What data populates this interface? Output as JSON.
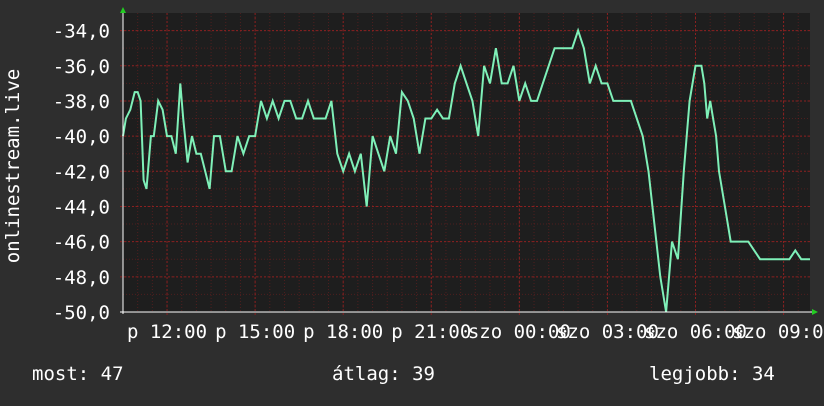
{
  "footer": {
    "current": "most: 47",
    "average": "átlag: 39",
    "best": "legjobb: 34"
  },
  "colors": {
    "background": "#2e2e2e",
    "plot_background": "#1e1e1e",
    "grid": "#8a2020",
    "line": "#7ff0b8",
    "axis_arrow": "#22cc22"
  },
  "chart_data": {
    "type": "line",
    "title": "",
    "xlabel": "",
    "ylabel": "onlinestream.live",
    "ylim": [
      -50,
      -33
    ],
    "ytick_values": [
      -34,
      -36,
      -38,
      -40,
      -42,
      -44,
      -46,
      -48,
      -50
    ],
    "ytick_labels": [
      "-34,0",
      "-36,0",
      "-38,0",
      "-40,0",
      "-42,0",
      "-44,0",
      "-46,0",
      "-48,0",
      "-50,0"
    ],
    "xlim": [
      10.5,
      33.9
    ],
    "xtick_values": [
      12,
      15,
      18,
      21,
      24,
      27,
      30,
      33
    ],
    "xtick_labels": [
      "p 12:00",
      "p 15:00",
      "p 18:00",
      "p 21:00",
      "szo 00:00",
      "szo 03:00",
      "szo 06:00",
      "szo 09:00"
    ],
    "grid": true,
    "series": [
      {
        "x": [
          10.5,
          10.6,
          10.75,
          10.9,
          11.0,
          11.1,
          11.2,
          11.3,
          11.45,
          11.55,
          11.7,
          11.85,
          12.0,
          12.15,
          12.3,
          12.45,
          12.55,
          12.7,
          12.85,
          13.0,
          13.15,
          13.3,
          13.45,
          13.6,
          13.8,
          14.0,
          14.2,
          14.4,
          14.6,
          14.8,
          15.0,
          15.2,
          15.4,
          15.6,
          15.8,
          16.0,
          16.2,
          16.4,
          16.6,
          16.8,
          17.0,
          17.2,
          17.4,
          17.6,
          17.8,
          18.0,
          18.2,
          18.4,
          18.6,
          18.8,
          19.0,
          19.2,
          19.4,
          19.6,
          19.8,
          20.0,
          20.2,
          20.4,
          20.6,
          20.8,
          21.0,
          21.2,
          21.4,
          21.6,
          21.8,
          22.0,
          22.2,
          22.4,
          22.6,
          22.8,
          23.0,
          23.2,
          23.4,
          23.6,
          23.8,
          24.0,
          24.2,
          24.4,
          24.6,
          24.8,
          25.0,
          25.2,
          25.4,
          25.6,
          25.8,
          26.0,
          26.2,
          26.4,
          26.6,
          26.8,
          27.0,
          27.2,
          27.4,
          27.6,
          27.8,
          28.0,
          28.2,
          28.4,
          28.6,
          28.8,
          29.0,
          29.2,
          29.4,
          29.6,
          29.8,
          30.0,
          30.1,
          30.2,
          30.3,
          30.4,
          30.5,
          30.6,
          30.7,
          30.8,
          31.0,
          31.2,
          31.4,
          31.6,
          31.8,
          32.0,
          32.2,
          32.4,
          32.6,
          32.8,
          33.0,
          33.2,
          33.4,
          33.6,
          33.8,
          33.9
        ],
        "y": [
          -40,
          -39,
          -38.5,
          -37.5,
          -37.5,
          -38,
          -42.5,
          -43,
          -40,
          -40,
          -38,
          -38.5,
          -40,
          -40,
          -41,
          -37,
          -39,
          -41.5,
          -40,
          -41,
          -41,
          -42,
          -43,
          -40,
          -40,
          -42,
          -42,
          -40,
          -41,
          -40,
          -40,
          -38,
          -39,
          -38,
          -39,
          -38,
          -38,
          -39,
          -39,
          -38,
          -39,
          -39,
          -39,
          -38,
          -41,
          -42,
          -41,
          -42,
          -41,
          -44,
          -40,
          -41,
          -42,
          -40,
          -41,
          -37.5,
          -38,
          -39,
          -41,
          -39,
          -39,
          -38.5,
          -39,
          -39,
          -37,
          -36,
          -37,
          -38,
          -40,
          -36,
          -37,
          -35,
          -37,
          -37,
          -36,
          -38,
          -37,
          -38,
          -38,
          -37,
          -36,
          -35,
          -35,
          -35,
          -35,
          -34,
          -35,
          -37,
          -36,
          -37,
          -37,
          -38,
          -38,
          -38,
          -38,
          -39,
          -40,
          -42,
          -45,
          -48,
          -50,
          -46,
          -47,
          -42,
          -38,
          -36,
          -36,
          -36,
          -37,
          -39,
          -38,
          -39,
          -40,
          -42,
          -44,
          -46,
          -46,
          -46,
          -46,
          -46.5,
          -47,
          -47,
          -47,
          -47,
          -47,
          -47,
          -46.5,
          -47,
          -47,
          -47
        ]
      }
    ]
  }
}
